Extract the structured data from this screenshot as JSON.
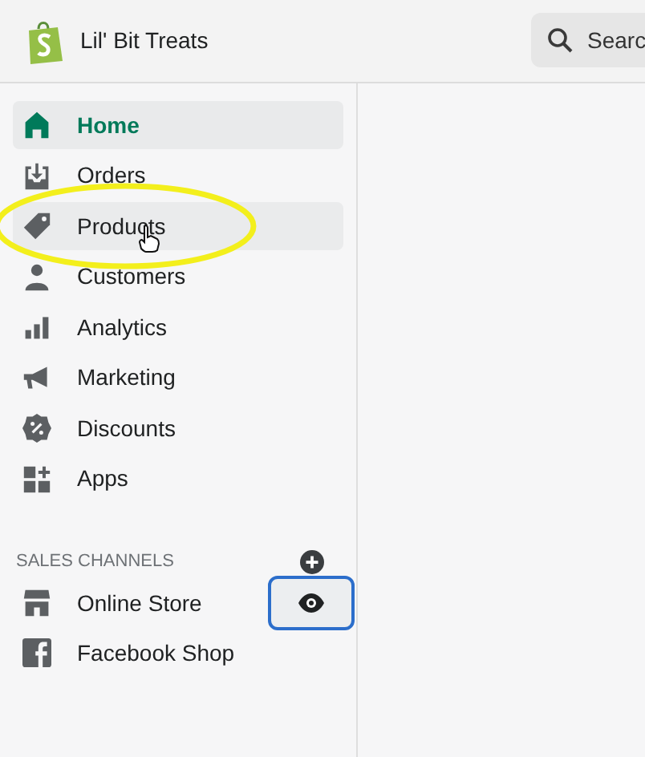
{
  "header": {
    "store_name": "Lil' Bit Treats",
    "search": {
      "placeholder": "Searc"
    }
  },
  "nav": [
    {
      "label": "Home",
      "selected": true,
      "hovered": false
    },
    {
      "label": "Orders",
      "selected": false,
      "hovered": false
    },
    {
      "label": "Products",
      "selected": false,
      "hovered": true
    },
    {
      "label": "Customers",
      "selected": false,
      "hovered": false
    },
    {
      "label": "Analytics",
      "selected": false,
      "hovered": false
    },
    {
      "label": "Marketing",
      "selected": false,
      "hovered": false
    },
    {
      "label": "Discounts",
      "selected": false,
      "hovered": false
    },
    {
      "label": "Apps",
      "selected": false,
      "hovered": false
    }
  ],
  "sales_channels": {
    "heading": "SALES CHANNELS",
    "items": [
      {
        "label": "Online Store",
        "view_button": true
      },
      {
        "label": "Facebook Shop",
        "view_button": false
      }
    ]
  },
  "annotation": {
    "kind": "ellipse"
  },
  "cursor": {
    "kind": "hand"
  }
}
